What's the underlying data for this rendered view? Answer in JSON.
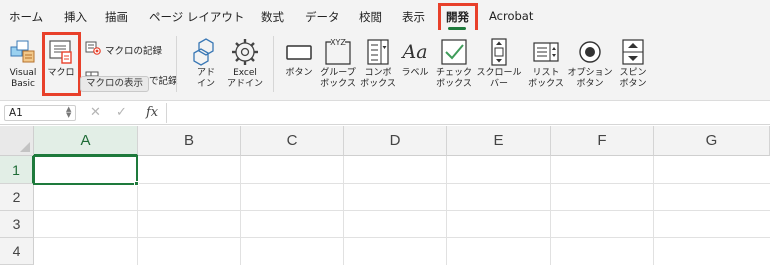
{
  "tabs": [
    {
      "label": "ホーム"
    },
    {
      "label": "挿入"
    },
    {
      "label": "描画"
    },
    {
      "label": "ページ レイアウト"
    },
    {
      "label": "数式"
    },
    {
      "label": "データ"
    },
    {
      "label": "校閲"
    },
    {
      "label": "表示"
    },
    {
      "label": "開発",
      "active": true
    },
    {
      "label": "Acrobat"
    }
  ],
  "ribbon": {
    "visual_basic": {
      "line1": "Visual",
      "line2": "Basic",
      "icon": "visual-basic-icon"
    },
    "macro": {
      "label": "マクロ",
      "icon": "macro-icon"
    },
    "record_macro": {
      "label": "マクロの記録",
      "icon": "record-macro-icon"
    },
    "relative_record": {
      "label": "で記録",
      "icon": "relative-reference-icon"
    },
    "tooltip": "マクロの表示",
    "addins": {
      "line1": "アド",
      "line2": "イン",
      "icon": "addins-icon"
    },
    "excel_addins": {
      "line1": "Excel",
      "line2": "アドイン",
      "icon": "gear-icon"
    },
    "controls": [
      {
        "line1": "ボタン",
        "line2": "",
        "icon": "button-control-icon"
      },
      {
        "line1": "グループ",
        "line2": "ボックス",
        "icon": "group-box-icon",
        "icon_text": "XYZ"
      },
      {
        "line1": "コンボ",
        "line2": "ボックス",
        "icon": "combo-box-icon"
      },
      {
        "line1": "ラベル",
        "line2": "",
        "icon": "label-control-icon",
        "icon_text": "Aa"
      },
      {
        "line1": "チェック",
        "line2": "ボックス",
        "icon": "checkbox-control-icon"
      },
      {
        "line1": "スクロール",
        "line2": "バー",
        "icon": "scrollbar-control-icon"
      },
      {
        "line1": "リスト",
        "line2": "ボックス",
        "icon": "list-box-icon"
      },
      {
        "line1": "オプション",
        "line2": "ボタン",
        "icon": "option-button-icon"
      },
      {
        "line1": "スピン",
        "line2": "ボタン",
        "icon": "spin-button-icon"
      }
    ]
  },
  "formula_bar": {
    "name_box": "A1",
    "cancel_glyph": "✕",
    "enter_glyph": "✓",
    "fx_label": "fx",
    "value": ""
  },
  "sheet": {
    "columns": [
      "A",
      "B",
      "C",
      "D",
      "E",
      "F",
      "G"
    ],
    "rows": [
      "1",
      "2",
      "3",
      "4"
    ],
    "selected_cell": "A1"
  },
  "colors": {
    "accent_green": "#1e7a3c",
    "highlight_red": "#e8402a",
    "ribbon_bg": "#f3f3f3"
  }
}
